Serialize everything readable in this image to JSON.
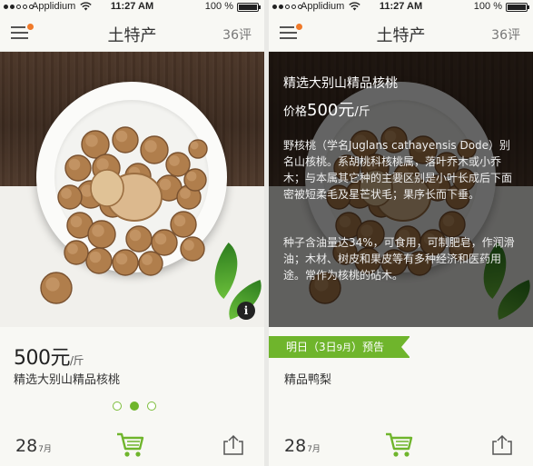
{
  "status": {
    "carrier": "Applidium",
    "time": "11:27 AM",
    "battery": "100 %"
  },
  "nav": {
    "title": "土特产",
    "review_count": "36评"
  },
  "product": {
    "price_value": "500元",
    "price_unit": "/斤",
    "name": "精选大别山精品核桃",
    "date_day": "28",
    "date_month": "7月"
  },
  "pager": {
    "count": 3,
    "active_index": 1
  },
  "info": {
    "title": "精选大别山精品核桃",
    "price_prefix": "价格",
    "price_value": "500元",
    "price_unit": "/斤",
    "paragraph1": "野核桃（学名Juglans cathayensis Dode）别名山核桃。系胡桃科核桃属，落叶乔木或小乔木；与本属其它种的主要区别是小叶长成后下面密被短柔毛及星芒状毛；果序长而下垂。",
    "paragraph2": "种子含油量达34%，可食用，可制肥皂，作润滑油；木材、树皮和果皮等有多种经济和医药用途。常作为核桃的砧木。"
  },
  "preview": {
    "prefix": "明日（3日",
    "month": "9月",
    "suffix": "）预告",
    "name": "精品鸭梨"
  },
  "icons": {
    "menu": "menu-icon",
    "info": "info-icon",
    "cart": "cart-icon",
    "share": "share-icon"
  },
  "colors": {
    "accent": "#6fb52c",
    "notification": "#f07a2a"
  }
}
